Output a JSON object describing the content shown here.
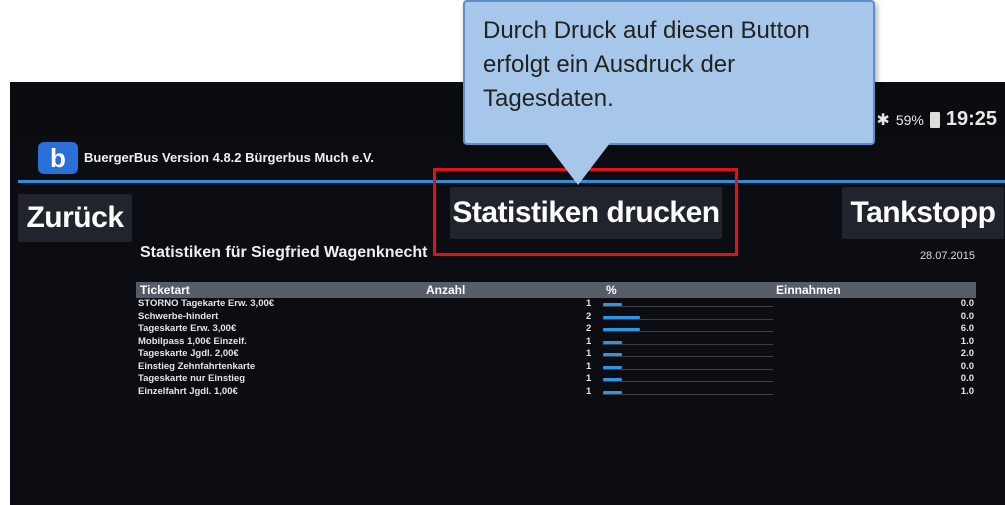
{
  "status": {
    "battery": "59%",
    "time": "19:25",
    "bluetooth_icon": "bluetooth-icon"
  },
  "app": {
    "logo_letter": "b",
    "title": "BuergerBus Version 4.8.2 Bürgerbus Much e.V."
  },
  "buttons": {
    "back": "Zurück",
    "print": "Statistiken drucken",
    "tank": "Tankstopp"
  },
  "stats": {
    "title": "Statistiken für Siegfried Wagenknecht",
    "date": "28.07.2015",
    "columns": {
      "ticket": "Ticketart",
      "count": "Anzahl",
      "percent": "%",
      "revenue": "Einnahmen"
    },
    "rows": [
      {
        "name": "STORNO Tagekarte Erw. 3,00€",
        "count": "1",
        "percent": 11,
        "revenue": "0.0"
      },
      {
        "name": "Schwerbe-hindert",
        "count": "2",
        "percent": 22,
        "revenue": "0.0"
      },
      {
        "name": "Tageskarte Erw. 3,00€",
        "count": "2",
        "percent": 22,
        "revenue": "6.0"
      },
      {
        "name": "Mobilpass 1,00€ Einzelf.",
        "count": "1",
        "percent": 11,
        "revenue": "1.0"
      },
      {
        "name": "Tageskarte Jgdl. 2,00€",
        "count": "1",
        "percent": 11,
        "revenue": "2.0"
      },
      {
        "name": "Einstieg Zehnfahrtenkarte",
        "count": "1",
        "percent": 11,
        "revenue": "0.0"
      },
      {
        "name": "Tageskarte nur Einstieg",
        "count": "1",
        "percent": 11,
        "revenue": "0.0"
      },
      {
        "name": "Einzelfahrt Jgdl. 1,00€",
        "count": "1",
        "percent": 11,
        "revenue": "1.0"
      }
    ]
  },
  "callout": {
    "text": "Durch Druck auf diesen Button erfolgt ein Ausdruck der Tagesdaten."
  },
  "colors": {
    "accent": "#2d8fd8",
    "highlight": "#e3101a",
    "callout_bg": "#a7c7ea"
  }
}
